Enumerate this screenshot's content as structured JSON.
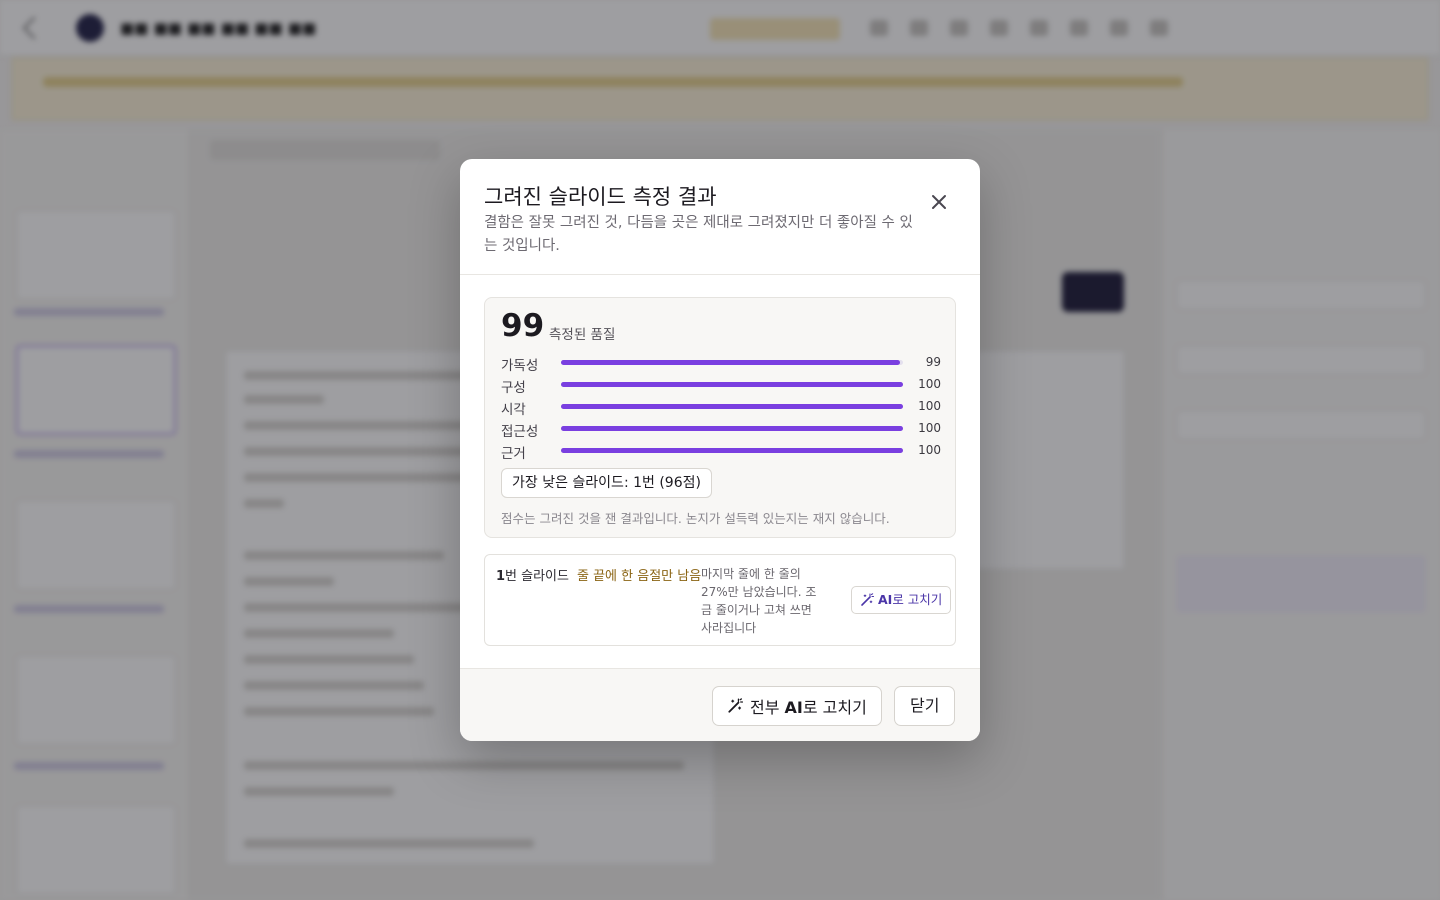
{
  "modal": {
    "title": "그려진 슬라이드 측정 결과",
    "subtitle": "결함은 잘못 그려진 것, 다듬을 곳은 제대로 그려졌지만 더 좋아질 수 있는 것입니다.",
    "close_icon": "close-icon"
  },
  "score": {
    "value": "99",
    "label": "측정된 품질",
    "accent_color": "#7a3fe0",
    "metrics": [
      {
        "name": "가독성",
        "value": "99",
        "level": 99
      },
      {
        "name": "구성",
        "value": "100",
        "level": 100
      },
      {
        "name": "시각",
        "value": "100",
        "level": 100
      },
      {
        "name": "접근성",
        "value": "100",
        "level": 100
      },
      {
        "name": "근거",
        "value": "100",
        "level": 100
      }
    ],
    "lowest_button": "가장 낮은 슬라이드: 1번 (96점)",
    "note": "점수는 그려진 것을 잰 결과입니다. 논지가 설득력 있는지는 재지 않습니다."
  },
  "issue": {
    "slide_number": "1",
    "slide_suffix": "번 슬라이드",
    "tag": "줄 끝에 한 음절만 남음",
    "description": "마지막 줄에 한 줄의 27%만 남았습니다. 조금 줄이거나 고쳐 쓰면 사라집니다",
    "fix_icon": "magic-wand-icon",
    "fix_ai": "AI",
    "fix_suffix": "로 고치기"
  },
  "footer": {
    "fix_all_prefix": "전부 ",
    "fix_all_ai": "AI",
    "fix_all_suffix": "로 고치기",
    "close": "닫기"
  }
}
